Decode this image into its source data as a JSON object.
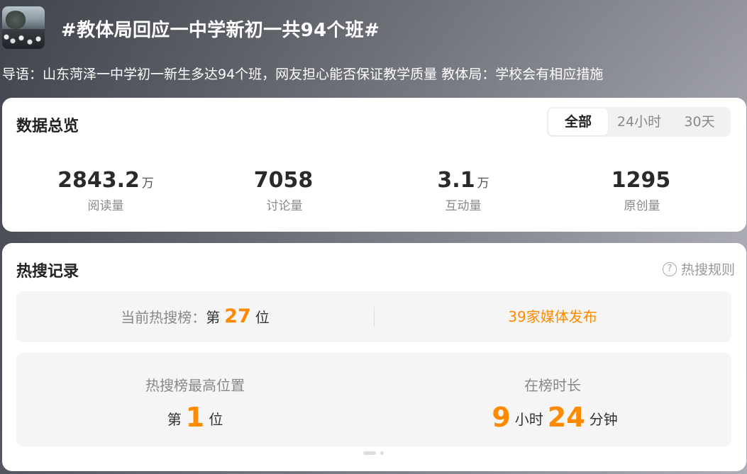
{
  "topic": {
    "title": "#教体局回应一中学新初一共94个班#",
    "lead": "导语：山东菏泽一中学初一新生多达94个班，网友担心能否保证教学质量 教体局：学校会有相应措施"
  },
  "overview": {
    "title": "数据总览",
    "tabs": [
      {
        "label": "全部"
      },
      {
        "label": "24小时"
      },
      {
        "label": "30天"
      }
    ],
    "active_tab": "全部",
    "stats": [
      {
        "value": "2843.2",
        "unit": "万",
        "label": "阅读量"
      },
      {
        "value": "7058",
        "unit": "",
        "label": "讨论量"
      },
      {
        "value": "3.1",
        "unit": "万",
        "label": "互动量"
      },
      {
        "value": "1295",
        "unit": "",
        "label": "原创量"
      }
    ]
  },
  "hot": {
    "title": "热搜记录",
    "rules_icon": "?",
    "rules_label": "热搜规则",
    "current": {
      "prefix": "当前热搜榜：",
      "rank_pre": "第",
      "rank": "27",
      "rank_post": "位",
      "media": "39家媒体发布"
    },
    "best": {
      "label": "热搜榜最高位置",
      "pre": "第",
      "rank": "1",
      "post": "位"
    },
    "duration": {
      "label": "在榜时长",
      "hours": "9",
      "hours_unit": "小时",
      "minutes": "24",
      "minutes_unit": "分钟"
    }
  },
  "colors": {
    "accent": "#ff8a00",
    "card": "#ffffff",
    "panel": "#f5f5f5"
  }
}
